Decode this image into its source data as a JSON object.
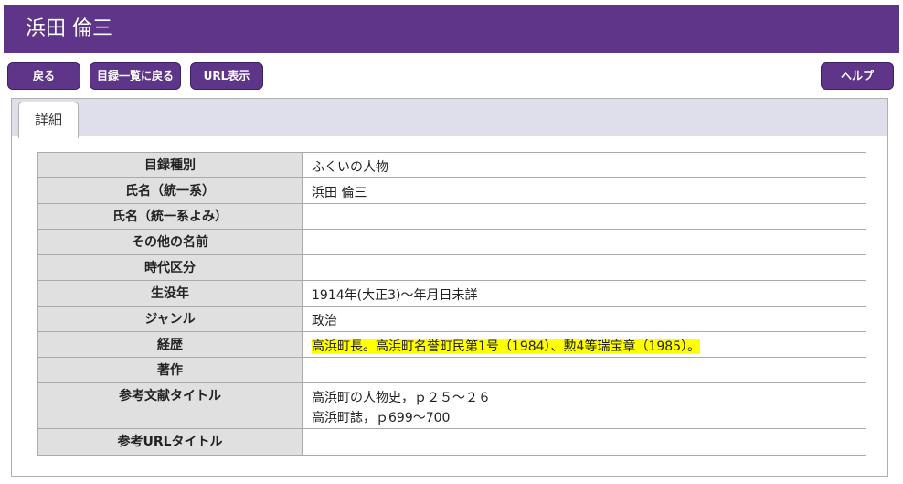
{
  "header": {
    "title": "浜田 倫三"
  },
  "toolbar": {
    "back": "戻る",
    "back_to_list": "目録一覧に戻る",
    "show_url": "URL表示",
    "help": "ヘルプ"
  },
  "tabs": [
    {
      "label": "詳細",
      "active": true
    }
  ],
  "colors": {
    "brand": "#5e3589",
    "highlight": "#ffff00",
    "label_bg": "#e0e0e0",
    "tab_strip": "#dedfea"
  },
  "detail": {
    "rows": [
      {
        "label": "目録種別",
        "value": "ふくいの人物"
      },
      {
        "label": "氏名（統一系）",
        "value": "浜田 倫三"
      },
      {
        "label": "氏名（統一系よみ）",
        "value": ""
      },
      {
        "label": "その他の名前",
        "value": ""
      },
      {
        "label": "時代区分",
        "value": ""
      },
      {
        "label": "生没年",
        "value": "1914年(大正3)～年月日未詳"
      },
      {
        "label": "ジャンル",
        "value": "政治"
      },
      {
        "label": "経歴",
        "value": "高浜町長。高浜町名誉町民第1号（1984）、勲4等瑞宝章（1985）。"
      },
      {
        "label": "著作",
        "value": ""
      },
      {
        "label": "参考文献タイトル",
        "value_lines": [
          "高浜町の人物史，ｐ２５～２６",
          "高浜町誌，ｐ699～700"
        ]
      },
      {
        "label": "参考URLタイトル",
        "value": ""
      }
    ]
  }
}
